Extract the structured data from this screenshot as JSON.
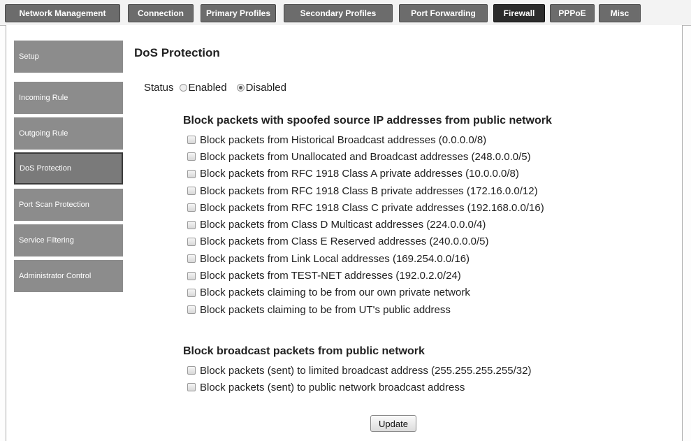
{
  "tabs": [
    {
      "label": "Network Management",
      "active": false
    },
    {
      "label": "Connection",
      "active": false
    },
    {
      "label": "Primary Profiles",
      "active": false
    },
    {
      "label": "Secondary Profiles",
      "active": false
    },
    {
      "label": "Port Forwarding",
      "active": false
    },
    {
      "label": "Firewall",
      "active": true
    },
    {
      "label": "PPPoE",
      "active": false
    },
    {
      "label": "Misc",
      "active": false
    }
  ],
  "sidebar": {
    "items": [
      {
        "label": "Setup",
        "active": false
      },
      {
        "label": "Incoming Rule",
        "active": false
      },
      {
        "label": "Outgoing Rule",
        "active": false
      },
      {
        "label": "DoS Protection",
        "active": true
      },
      {
        "label": "Port Scan Protection",
        "active": false
      },
      {
        "label": "Service Filtering",
        "active": false
      },
      {
        "label": "Administrator Control",
        "active": false
      }
    ]
  },
  "main": {
    "title": "DoS Protection",
    "status": {
      "label": "Status",
      "options": [
        {
          "label": "Enabled",
          "checked": false
        },
        {
          "label": "Disabled",
          "checked": true
        }
      ]
    },
    "spoofed_section": {
      "heading": "Block packets with spoofed source IP addresses from public network",
      "options": [
        {
          "label": "Block packets from Historical Broadcast addresses (0.0.0.0/8)",
          "checked": false
        },
        {
          "label": "Block packets from Unallocated and Broadcast addresses (248.0.0.0/5)",
          "checked": false
        },
        {
          "label": "Block packets from RFC 1918 Class A private addresses (10.0.0.0/8)",
          "checked": false
        },
        {
          "label": "Block packets from RFC 1918 Class B private addresses (172.16.0.0/12)",
          "checked": false
        },
        {
          "label": "Block packets from RFC 1918 Class C private addresses (192.168.0.0/16)",
          "checked": false
        },
        {
          "label": "Block packets from Class D Multicast addresses (224.0.0.0/4)",
          "checked": false
        },
        {
          "label": "Block packets from Class E Reserved addresses (240.0.0.0/5)",
          "checked": false
        },
        {
          "label": "Block packets from Link Local addresses (169.254.0.0/16)",
          "checked": false
        },
        {
          "label": "Block packets from TEST-NET addresses (192.0.2.0/24)",
          "checked": false
        },
        {
          "label": "Block packets claiming to be from our own private network",
          "checked": false
        },
        {
          "label": "Block packets claiming to be from UT's public address",
          "checked": false
        }
      ]
    },
    "broadcast_section": {
      "heading": "Block broadcast packets from public network",
      "options": [
        {
          "label": "Block packets (sent) to limited broadcast address (255.255.255.255/32)",
          "checked": false
        },
        {
          "label": "Block packets (sent) to public network broadcast address",
          "checked": false
        }
      ]
    },
    "update_label": "Update"
  }
}
